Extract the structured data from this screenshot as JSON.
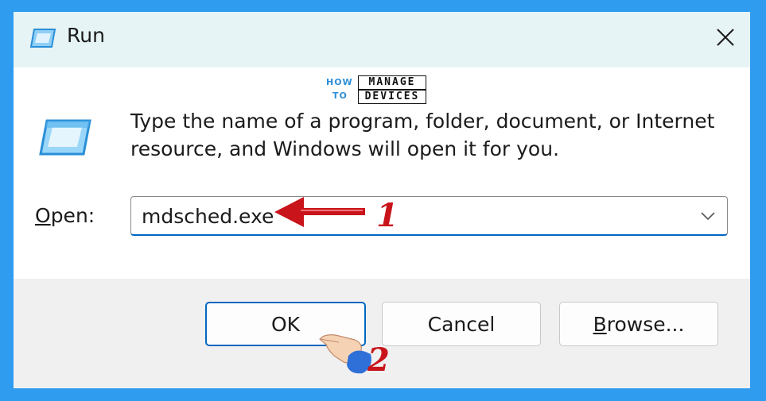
{
  "window": {
    "title": "Run",
    "title_icon": "run-icon",
    "close_icon": "close-icon"
  },
  "watermark": {
    "how": "HOW",
    "to": "TO",
    "manage": "MANAGE",
    "devices": "DEVICES"
  },
  "description": "Type the name of a program, folder, document, or Internet resource, and Windows will open it for you.",
  "open": {
    "label_accesskey": "O",
    "label_rest": "pen:",
    "value": "mdsched.exe",
    "dropdown_icon": "chevron-down-icon"
  },
  "buttons": {
    "ok": "OK",
    "cancel": "Cancel",
    "browse_accesskey": "B",
    "browse_rest": "rowse..."
  },
  "annotations": {
    "step1": "1",
    "step2": "2",
    "arrow_icon": "red-arrow-icon",
    "hand_icon": "pointing-hand-icon"
  },
  "colors": {
    "background": "#2f9cf0",
    "titlebar": "#e6f4f5",
    "accent": "#0067c0",
    "annotation": "#c9141c"
  }
}
